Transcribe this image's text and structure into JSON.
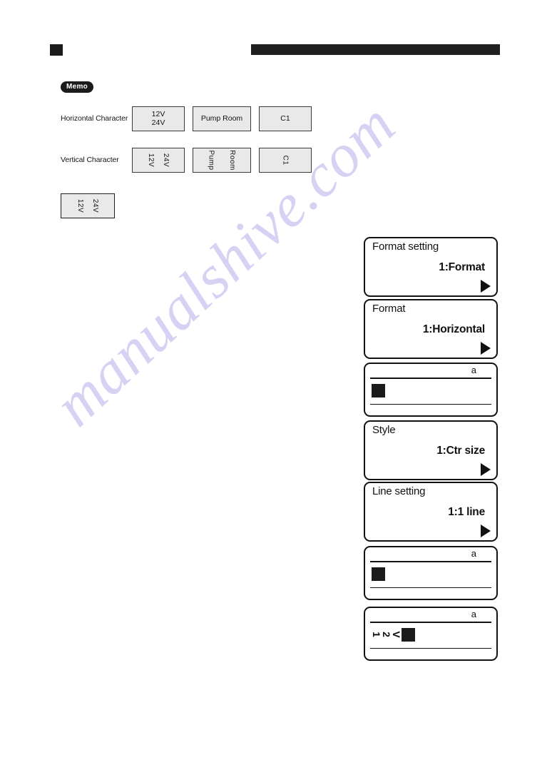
{
  "page": {
    "marker_icon": "black-square-marker",
    "header_bar_color": "#1f1f1f",
    "watermark_text": "manualshive.com",
    "watermark_color": "#c9c4f0"
  },
  "memo": {
    "label": "Memo"
  },
  "comparison": {
    "rows": [
      {
        "label": "Horizontal Character",
        "orientation": "horizontal",
        "cells": [
          {
            "text": "12V\n24V",
            "lines": [
              "12V",
              "24V"
            ]
          },
          {
            "text": "Pump Room",
            "lines": [
              "Pump Room"
            ]
          },
          {
            "text": "C1",
            "lines": [
              "C1"
            ]
          }
        ]
      },
      {
        "label": "Vertical Character",
        "orientation": "vertical",
        "cells": [
          {
            "text": "12V 24V",
            "lines": [
              "12V",
              "24V"
            ]
          },
          {
            "text": "Pump Room",
            "lines": [
              "Pump",
              "Room"
            ]
          },
          {
            "text": "C1",
            "lines": [
              "C1"
            ]
          }
        ]
      }
    ]
  },
  "standalone_example": {
    "lines": [
      "12V",
      "24V"
    ],
    "orientation": "vertical"
  },
  "lcd_screens": [
    {
      "type": "menu",
      "title": "Format setting",
      "value": "1:Format",
      "arrow_icon": "right-triangle-icon"
    },
    {
      "type": "menu",
      "title": "Format",
      "value": "1:Horizontal",
      "arrow_icon": "right-triangle-icon"
    },
    {
      "type": "edit",
      "indicator": "a",
      "content": "",
      "cursor": true
    },
    {
      "type": "menu",
      "title": "Style",
      "value": "1:Ctr size",
      "arrow_icon": "right-triangle-icon"
    },
    {
      "type": "menu",
      "title": "Line setting",
      "value": "1:1 line",
      "arrow_icon": "right-triangle-icon"
    },
    {
      "type": "edit",
      "indicator": "a",
      "content": "",
      "cursor": true
    },
    {
      "type": "edit",
      "indicator": "a",
      "content": "12V",
      "content_chars": [
        "1",
        "2",
        "V"
      ],
      "cursor": true
    }
  ]
}
